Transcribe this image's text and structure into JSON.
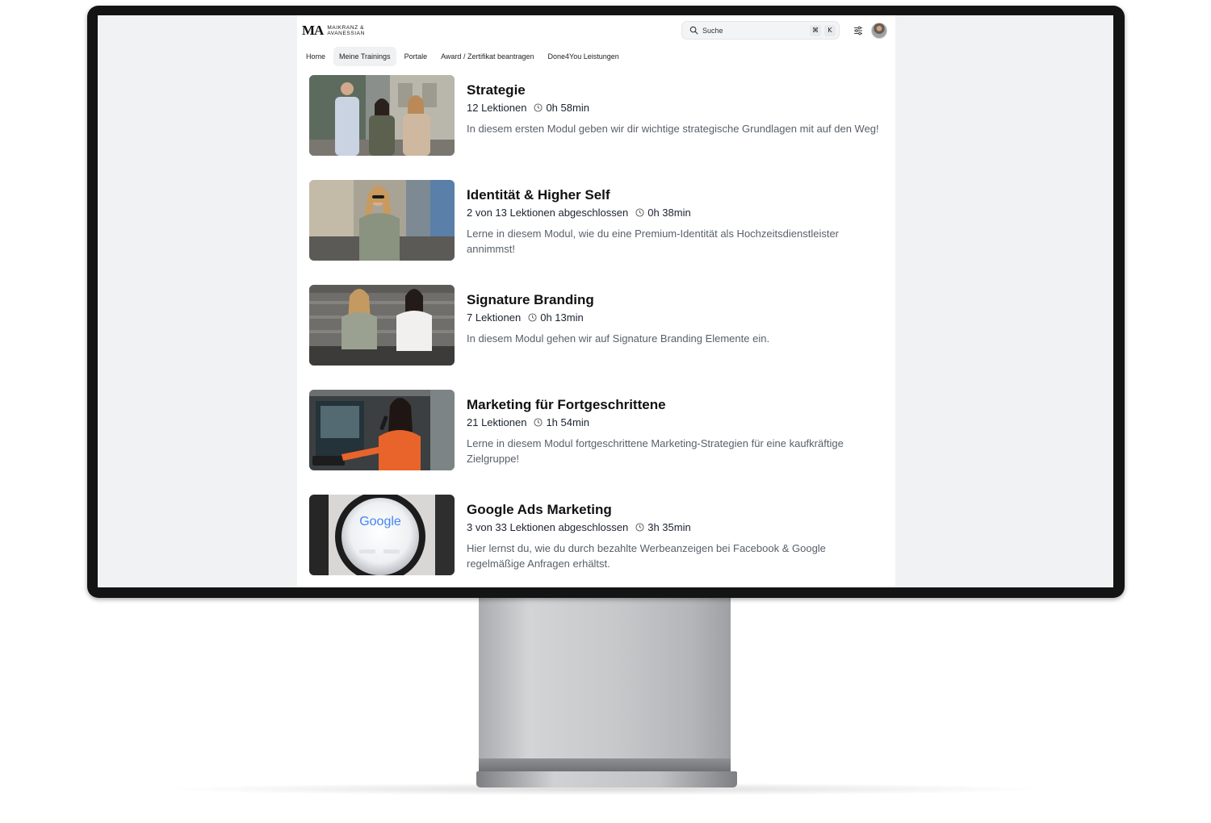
{
  "brand": {
    "mark": "MA",
    "name_line1": "MAIKRANZ &",
    "name_line2": "AVANESSIAN"
  },
  "search": {
    "placeholder": "Suche",
    "shortcut_cmd": "⌘",
    "shortcut_key": "K"
  },
  "icons": {
    "search": "search-icon",
    "filter": "sliders-icon",
    "clock": "clock-icon",
    "avatar": "user-avatar"
  },
  "nav": {
    "items": [
      {
        "label": "Home",
        "active": false
      },
      {
        "label": "Meine Trainings",
        "active": true
      },
      {
        "label": "Portale",
        "active": false
      },
      {
        "label": "Award / Zertifikat beantragen",
        "active": false
      },
      {
        "label": "Done4You Leistungen",
        "active": false
      }
    ]
  },
  "modules": [
    {
      "title": "Strategie",
      "lessons": "12 Lektionen",
      "duration": "0h 58min",
      "description": "In diesem ersten Modul geben wir dir wichtige strategische Grundlagen mit auf den Weg!"
    },
    {
      "title": "Identität & Higher Self",
      "lessons": "2 von 13 Lektionen abgeschlossen",
      "duration": "0h 38min",
      "description": "Lerne in diesem Modul, wie du eine Premium-Identität als Hochzeitsdienstleister annimmst!"
    },
    {
      "title": "Signature Branding",
      "lessons": "7 Lektionen",
      "duration": "0h 13min",
      "description": "In diesem Modul gehen wir auf Signature Branding Elemente ein."
    },
    {
      "title": "Marketing für Fortgeschrittene",
      "lessons": "21 Lektionen",
      "duration": "1h 54min",
      "description": "Lerne in diesem Modul fortgeschrittene Marketing-Strategien für eine kaufkräftige Zielgruppe!"
    },
    {
      "title": "Google Ads Marketing",
      "lessons": "3 von 33 Lektionen abgeschlossen",
      "duration": "3h 35min",
      "description": "Hier lernst du, wie du durch bezahlte Werbeanzeigen bei Facebook & Google regelmäßige Anfragen erhältst."
    }
  ],
  "thumb_text": {
    "google": "Google"
  },
  "colors": {
    "google_blue": "#4285F4",
    "google_red": "#EA4335",
    "google_yellow": "#FBBC05",
    "google_green": "#34A853",
    "accent_orange": "#e8642a"
  }
}
